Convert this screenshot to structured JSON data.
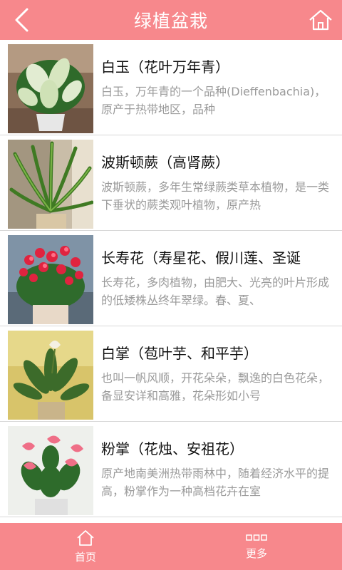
{
  "header": {
    "title": "绿植盆栽",
    "back_icon": "chevron-left-icon",
    "home_icon": "home-icon"
  },
  "items": [
    {
      "title": "白玉（花叶万年青）",
      "desc": "白玉，万年青的一个品种(Dieffenbachia)，原产于热带地区，品种"
    },
    {
      "title": "波斯顿蕨（高肾蕨）",
      "desc": "波斯顿蕨，多年生常绿蕨类草本植物，是一类下垂状的蕨类观叶植物，原产热"
    },
    {
      "title": "长寿花（寿星花、假川莲、圣诞",
      "desc": "长寿花，多肉植物，由肥大、光亮的叶片形成的低矮株丛终年翠绿。春、夏、"
    },
    {
      "title": "白掌（苞叶芋、和平芋）",
      "desc": "也叫一帆风顺，开花朵朵，飘逸的白色花朵，备显安详和高雅，花朵形如小号"
    },
    {
      "title": "粉掌（花烛、安祖花）",
      "desc": "原产地南美洲热带雨林中，随着经济水平的提高，粉掌作为一种高档花卉在室"
    }
  ],
  "tabbar": {
    "home_label": "首页",
    "more_label": "更多"
  },
  "colors": {
    "accent": "#f7888c",
    "title_text": "#111111",
    "desc_text": "#9a9a9a"
  }
}
